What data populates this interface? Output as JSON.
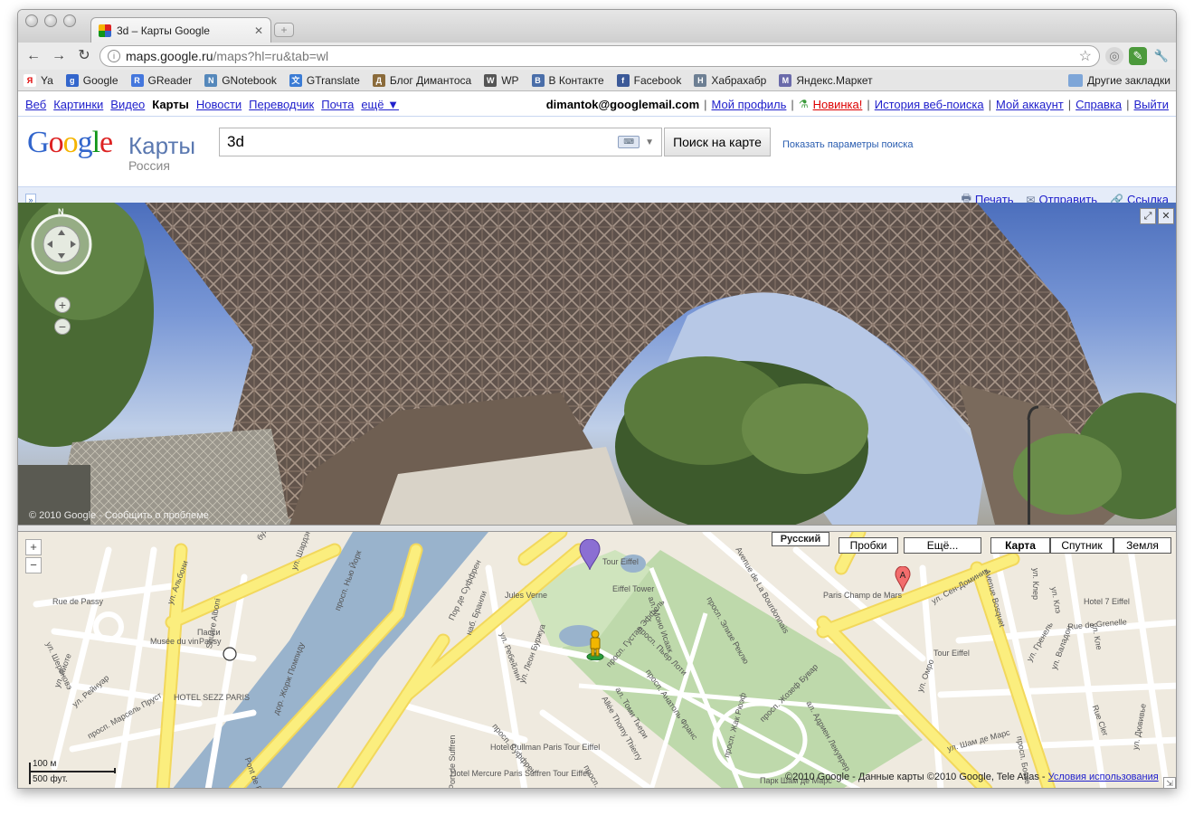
{
  "browser": {
    "tab_title": "3d – Карты Google",
    "url_host": "maps.google.ru",
    "url_path": "/maps?hl=ru&tab=wl",
    "bookmarks": [
      {
        "label": "Ya",
        "color": "#ffffff",
        "glyph": "Я",
        "text_color": "#e00000"
      },
      {
        "label": "Google",
        "color": "#3366cc",
        "glyph": "g",
        "text_color": "#ffffff"
      },
      {
        "label": "GReader",
        "color": "#4477dd",
        "glyph": "R",
        "text_color": "#ffffff"
      },
      {
        "label": "GNotebook",
        "color": "#5588bb",
        "glyph": "N",
        "text_color": "#ffffff"
      },
      {
        "label": "GTranslate",
        "color": "#3a7bd5",
        "glyph": "文",
        "text_color": "#ffffff"
      },
      {
        "label": "Блог Димантоса",
        "color": "#8a6a3a",
        "glyph": "Д",
        "text_color": "#ffffff"
      },
      {
        "label": "WP",
        "color": "#555555",
        "glyph": "W",
        "text_color": "#ffffff"
      },
      {
        "label": "В Контакте",
        "color": "#4a6ea9",
        "glyph": "B",
        "text_color": "#ffffff"
      },
      {
        "label": "Facebook",
        "color": "#3b5998",
        "glyph": "f",
        "text_color": "#ffffff"
      },
      {
        "label": "Хабрахабр",
        "color": "#6d7f93",
        "glyph": "H",
        "text_color": "#ffffff"
      },
      {
        "label": "Яндекс.Маркет",
        "color": "#6a6aaa",
        "glyph": "M",
        "text_color": "#ffffff"
      }
    ],
    "other_bookmarks": "Другие закладки"
  },
  "gbar": {
    "links": [
      {
        "label": "Веб",
        "current": false
      },
      {
        "label": "Картинки",
        "current": false
      },
      {
        "label": "Видео",
        "current": false
      },
      {
        "label": "Карты",
        "current": true
      },
      {
        "label": "Новости",
        "current": false
      },
      {
        "label": "Переводчик",
        "current": false
      },
      {
        "label": "Почта",
        "current": false
      },
      {
        "label": "ещё ▼",
        "current": false
      }
    ],
    "email": "dimantok@googlemail.com",
    "profile": "Мой профиль",
    "new": "Новинка!",
    "history": "История веб-поиска",
    "account": "Мой аккаунт",
    "help": "Справка",
    "logout": "Выйти"
  },
  "header": {
    "logo_letters": [
      {
        "ch": "G",
        "color": "#3366cc"
      },
      {
        "ch": "o",
        "color": "#dd2222"
      },
      {
        "ch": "o",
        "color": "#f5b400"
      },
      {
        "ch": "g",
        "color": "#3366cc"
      },
      {
        "ch": "l",
        "color": "#109618"
      },
      {
        "ch": "e",
        "color": "#dd2222"
      }
    ],
    "product": "Карты",
    "country": "Россия",
    "search_value": "3d",
    "search_button": "Поиск на карте",
    "search_options": "Показать параметры поиска"
  },
  "actionbar": {
    "print": "Печать",
    "send": "Отправить",
    "link": "Ссылка"
  },
  "streetview": {
    "north": "N",
    "copyright": "© 2010 Google - Сообщить о проблеме"
  },
  "map": {
    "language": "Русский",
    "traffic": "Пробки",
    "more": "Ещё...",
    "types": [
      "Карта",
      "Спутник",
      "Земля"
    ],
    "active_type": "Карта",
    "scale_metric": "100 м",
    "scale_imperial": "500 фут.",
    "copyright": "©2010 Google - Данные карты ©2010 Google, Tele Atlas -",
    "terms": "Условия использования",
    "marker_letter": "A",
    "labels": [
      "бул. Делессер",
      "ул. Шардэн",
      "Rue de Passy",
      "ул. Альбони",
      "просп. Нью Йорк",
      "Пасси",
      "Passy",
      "Musée du vin",
      "Square Alboni",
      "ул. Шериновэ",
      "ул. Лиоте",
      "ул. Рейнуар",
      "просп. Марсель Пруст",
      "HOTEL SEZZ PARIS",
      "дор. Жорж Помпиду",
      "Pont de Bir Hakeim",
      "наб. Бранли",
      "Пор де Суффрен",
      "ул. Ребейлин",
      "ул. Леон Буржуа",
      "просп. Суффрен",
      "Port de Suffren",
      "Hotel Pullman Paris Tour Eiffel",
      "Hotel Mercure Paris Suffren Tour Eiffel",
      "Jules Verne",
      "Eiffel Tower",
      "Tour Eiffel",
      "просп. Густав Эффель",
      "ал. Моно Исаак",
      "просп. Анатоль Франс",
      "просп. Пьер Лоти",
      "ал. Томи Тьери",
      "Allée Thomy Thierry",
      "просп. Шарль Флоке",
      "просп. Жак Рюэф",
      "просп. Жозеф Бувар",
      "ал. Адриен Лекуврер",
      "просп. Элизе Реклю",
      "Avenue de La Bourdonnais",
      "Paris Champ de Mars",
      "Парк Шам де Марс",
      "ул. Сен-Доминик",
      "Avenue Bosquet",
      "ул. Клер",
      "Hotel 7 Eiffel",
      "Rue de Grenelle",
      "ул. Гренель",
      "ул. Валадон",
      "ул. Шам де Марс",
      "просп. Боске",
      "Rue Cler",
      "ул. Дювивье",
      "ул. Омро",
      "Tour Eiffel",
      "ул. Клэ",
      "ул. Кле"
    ]
  },
  "colors": {
    "link": "#2020cc",
    "water": "#99b3cc",
    "park": "#bed9ab",
    "major_road": "#fbee7e",
    "map_bg": "#efeadf"
  }
}
